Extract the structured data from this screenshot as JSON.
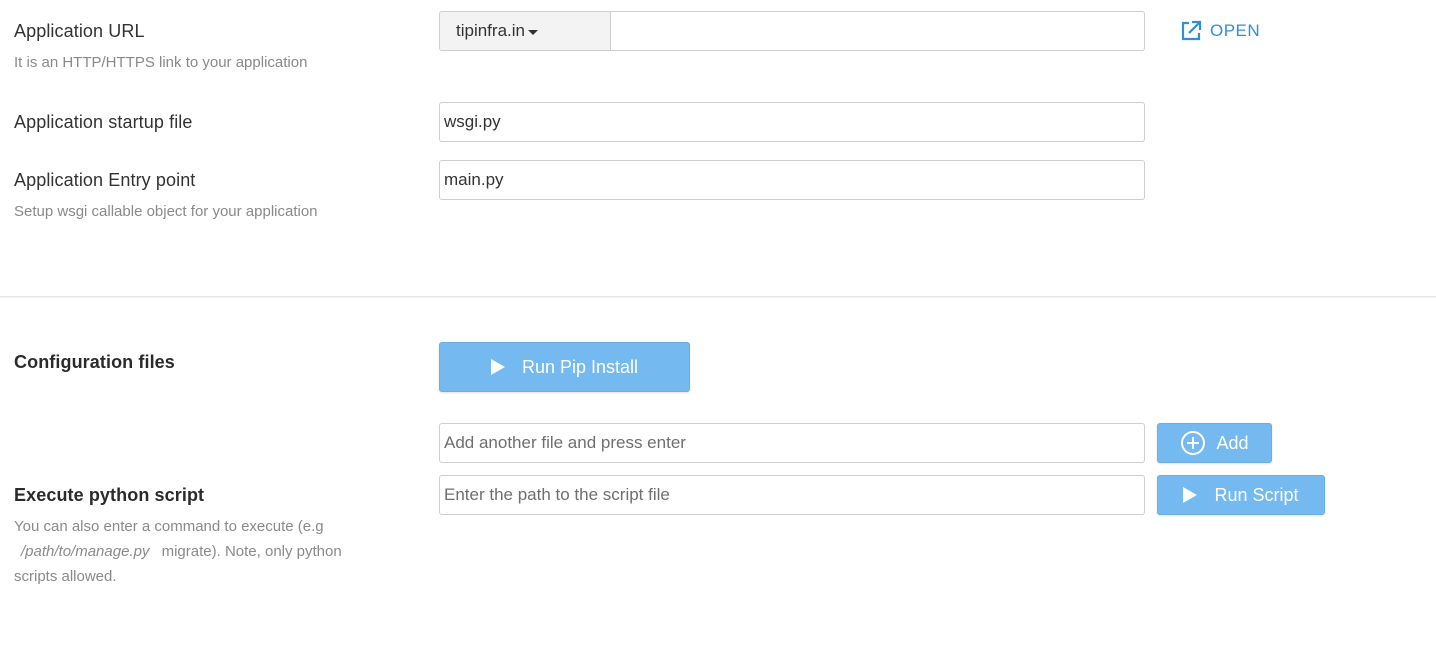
{
  "app_url": {
    "label": "Application URL",
    "hint": "It is an HTTP/HTTPS link to your application",
    "domain": "tipinfra.in",
    "value": "",
    "open_label": "OPEN"
  },
  "startup_file": {
    "label": "Application startup file",
    "value": "wsgi.py"
  },
  "entry_point": {
    "label": "Application Entry point",
    "hint": "Setup wsgi callable object for your application",
    "value": "main.py"
  },
  "config_files": {
    "label": "Configuration files",
    "run_pip_label": "Run Pip Install",
    "add_placeholder": "Add another file and press enter",
    "add_label": "Add"
  },
  "python_script": {
    "label": "Execute python script",
    "hint_part1": "You can also enter a command to execute (e.g",
    "hint_path": "/path/to/manage.py",
    "hint_part2": "migrate). Note, only python scripts allowed.",
    "placeholder": "Enter the path to the script file",
    "run_label": "Run Script"
  },
  "colors": {
    "accent": "#2f8fd8",
    "button": "#74b9ef"
  }
}
